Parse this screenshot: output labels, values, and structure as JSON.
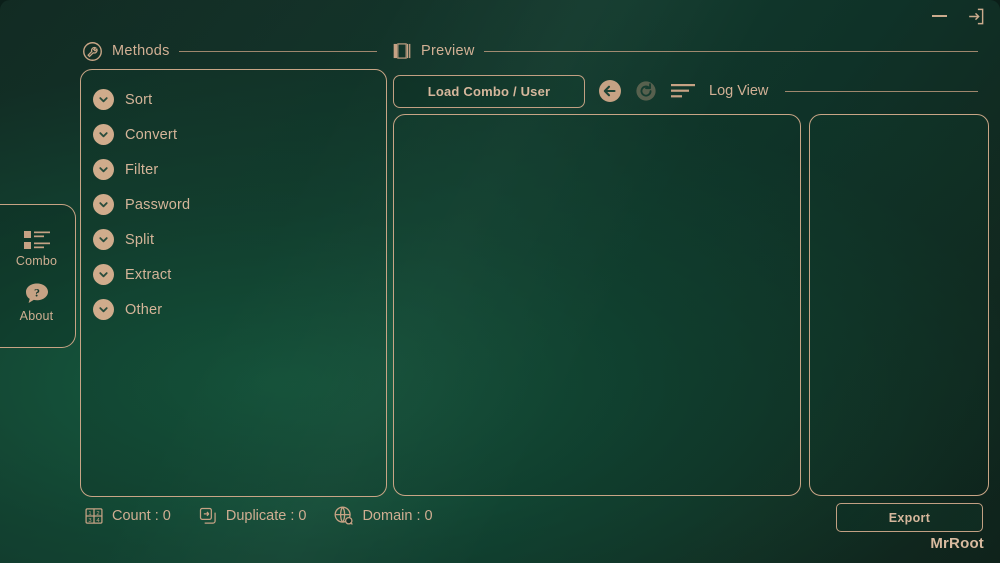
{
  "window": {
    "minimize_icon": "minimize-icon",
    "exit_icon": "exit-icon"
  },
  "sidebar": {
    "items": [
      {
        "label": "Combo",
        "icon": "list-checklist-icon"
      },
      {
        "label": "About",
        "icon": "question-bubble-icon"
      }
    ]
  },
  "methods": {
    "header": {
      "title": "Methods",
      "icon": "wrench-circle-icon"
    },
    "items": [
      {
        "label": "Sort",
        "icon": "chevron-down-icon"
      },
      {
        "label": "Convert",
        "icon": "chevron-down-icon"
      },
      {
        "label": "Filter",
        "icon": "chevron-down-icon"
      },
      {
        "label": "Password",
        "icon": "chevron-down-icon"
      },
      {
        "label": "Split",
        "icon": "chevron-down-icon"
      },
      {
        "label": "Extract",
        "icon": "chevron-down-icon"
      },
      {
        "label": "Other",
        "icon": "chevron-down-icon"
      }
    ]
  },
  "preview": {
    "header": {
      "title": "Preview",
      "icon": "book-pages-icon"
    },
    "toolbar": {
      "load_label": "Load Combo / User",
      "back_icon": "back-arrow-circle-icon",
      "refresh_icon": "refresh-circle-icon",
      "lines_icon": "list-lines-icon",
      "logview_label": "Log View"
    }
  },
  "status": [
    {
      "label": "Count : 0",
      "icon": "count-numbers-icon"
    },
    {
      "label": "Duplicate : 0",
      "icon": "duplicate-copy-icon"
    },
    {
      "label": "Domain : 0",
      "icon": "globe-search-icon"
    }
  ],
  "footer": {
    "export_label": "Export",
    "brand": "MrRoot"
  },
  "colors": {
    "accent": "#c8a586",
    "text": "#d2b094",
    "bg_dark": "#122b23",
    "bg_mid": "#11392c"
  }
}
